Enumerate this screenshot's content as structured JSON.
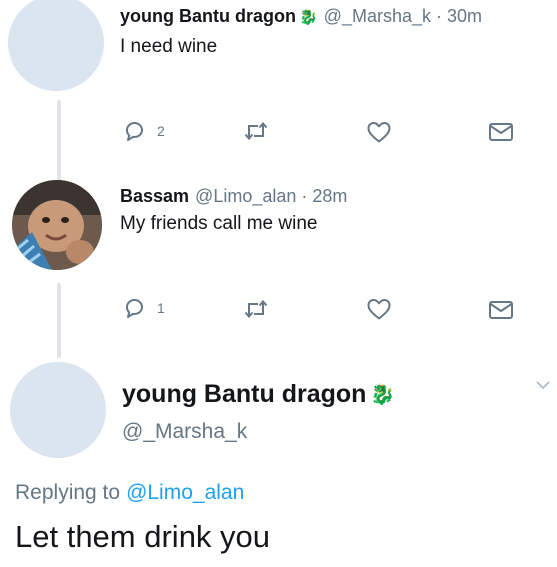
{
  "tweet1": {
    "name": "young Bantu dragon",
    "emoji": "🐉",
    "handle": "@_Marsha_k",
    "sep": "·",
    "time": "30m",
    "text": "I need wine",
    "reply_count": "2",
    "icons": [
      "reply-icon",
      "retweet-icon",
      "like-icon",
      "message-icon"
    ]
  },
  "tweet2": {
    "name": "Bassam",
    "handle": "@Limo_alan",
    "sep": "·",
    "time": "28m",
    "text": "My friends call me wine",
    "reply_count": "1",
    "icons": [
      "reply-icon",
      "retweet-icon",
      "like-icon",
      "message-icon"
    ]
  },
  "tweet3": {
    "name": "young Bantu dragon",
    "emoji": "🐉",
    "handle": "@_Marsha_k",
    "replying_prefix": "Replying to",
    "replying_to": "@Limo_alan",
    "text": "Let them drink you",
    "menu_icon": "chevron-down-icon"
  },
  "colors": {
    "text": "#14171a",
    "secondary": "#657786",
    "link": "#1da1f2",
    "avatar_placeholder": "#dbe5ef",
    "thread_line": "#dfe4e9"
  }
}
